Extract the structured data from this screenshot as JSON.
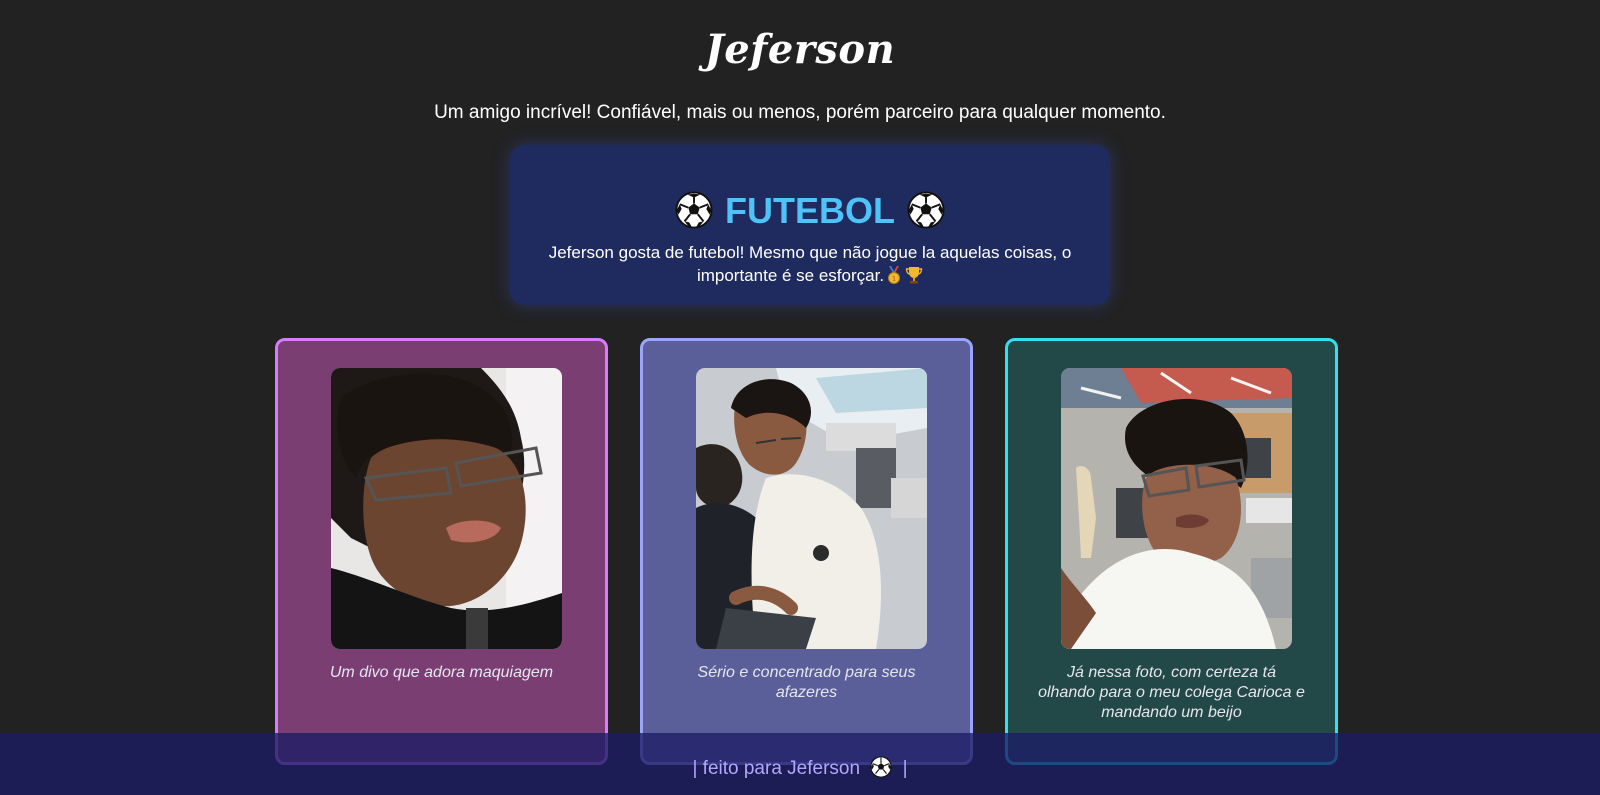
{
  "header": {
    "title": "Jeferson",
    "subtitle": "Um amigo incrível! Confiável, mais ou menos, porém parceiro para qualquer momento."
  },
  "hobby": {
    "title": "FUTEBOL",
    "text": "Jeferson gosta de futebol! Mesmo que não jogue la aquelas coisas, o importante é se esforçar.",
    "icons": [
      "soccer-ball-icon",
      "medal-icon",
      "trophy-icon"
    ]
  },
  "cards": [
    {
      "caption": "Um divo que adora maquiagem",
      "accent": "#d77bff",
      "background": "#7a3e73"
    },
    {
      "caption": "Sério e concentrado para seus afazeres",
      "accent": "#9ba5ff",
      "background": "#5a5f99"
    },
    {
      "caption": "Já nessa foto, com certeza tá olhando para o meu colega Carioca e mandando um beijo",
      "accent": "#2ee2ee",
      "background": "#234848"
    }
  ],
  "footer": {
    "prefix": "| feito para Jeferson",
    "suffix": "|"
  },
  "colors": {
    "page_background": "#222222",
    "hobby_background": "#1f2b5e",
    "hobby_title": "#4fc3f7",
    "footer_text": "#b0a8ff"
  }
}
